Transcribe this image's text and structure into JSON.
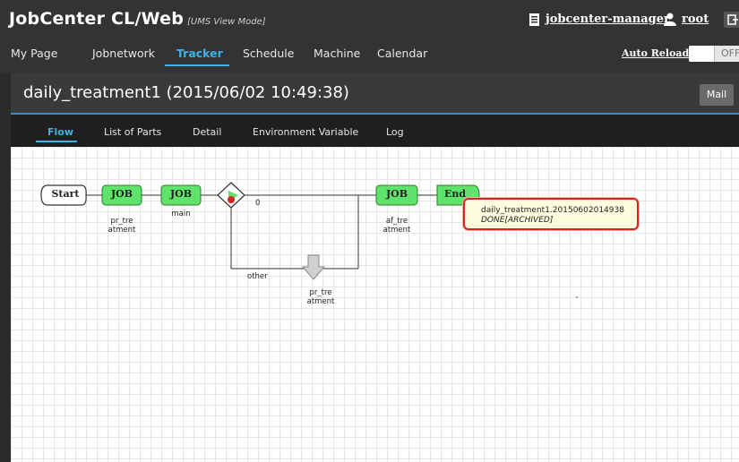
{
  "header": {
    "app_title": "JobCenter CL/Web",
    "mode": "[UMS View Mode]",
    "server": "jobcenter-manager",
    "user": "root",
    "auto_reload_label": "Auto Reload",
    "auto_reload_state": "OFF"
  },
  "nav": {
    "items": [
      "My Page",
      "Jobnetwork",
      "Tracker",
      "Schedule",
      "Machine",
      "Calendar"
    ],
    "active": "Tracker"
  },
  "tracker": {
    "title": "daily_treatment1 (2015/06/02 10:49:38)",
    "mail_label": "Mail"
  },
  "tabs": {
    "items": [
      "Flow",
      "List of Parts",
      "Detail",
      "Environment Variable",
      "Log"
    ],
    "active": "Flow"
  },
  "flow": {
    "start_label": "Start",
    "end_label": "End",
    "job_label": "JOB",
    "jobs": [
      {
        "name_line1": "pr_tre",
        "name_line2": "atment"
      },
      {
        "name_line1": "main",
        "name_line2": ""
      },
      {
        "name_line1": "af_tre",
        "name_line2": "atment"
      }
    ],
    "branch_label_0": "0",
    "branch_label_other": "other",
    "sub_job": {
      "name_line1": "pr_tre",
      "name_line2": "atment"
    }
  },
  "tooltip": {
    "line1": "daily_treatment1.20150602014938",
    "line2": "DONE[ARCHIVED]"
  },
  "colors": {
    "accent": "#3fb1e6",
    "job_green": "#5fe36a",
    "tooltip_border": "#d9231e",
    "header_bg": "#333336"
  }
}
